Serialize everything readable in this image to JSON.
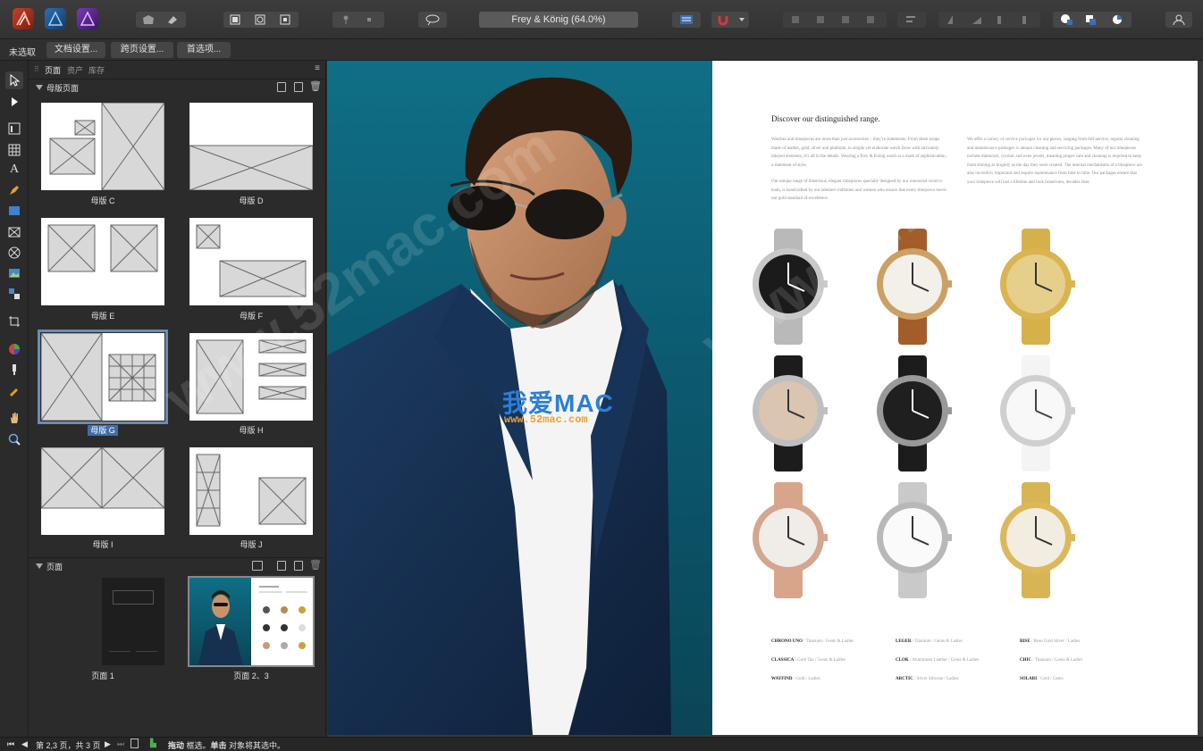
{
  "toolbar": {
    "apps": [
      "affinity-publisher-icon",
      "affinity-designer-icon",
      "affinity-photo-icon"
    ],
    "document_title": "Frey & König (64.0%)"
  },
  "context_bar": {
    "selection_label": "未选取",
    "doc_setup_button": "文档设置...",
    "spread_setup_button": "跨页设置...",
    "preferences_button": "首选项..."
  },
  "panel": {
    "tabs": [
      "页面",
      "资产",
      "库存"
    ],
    "master_section_title": "母版页面",
    "pages_section_title": "页面",
    "masters": [
      {
        "label": "母版 C"
      },
      {
        "label": "母版 D"
      },
      {
        "label": "母版 E"
      },
      {
        "label": "母版 F"
      },
      {
        "label": "母版 G",
        "selected": true
      },
      {
        "label": "母版 H"
      },
      {
        "label": "母版 I"
      },
      {
        "label": "母版 J"
      }
    ],
    "pages": [
      {
        "label": "页面 1"
      },
      {
        "label": "页面 2、3",
        "selected": true
      }
    ]
  },
  "document": {
    "heading": "Discover our distinguished range.",
    "para_left": "Watches and timepieces are more than just accessories – they’re statements. From sleek straps made of leather, gold, silver and platinum, to simple yet elaborate watch faces with intricately inlayed elements, it’s all in the details. Wearing a Frey & König watch is a mark of sophistication, a statement of style.",
    "para_left2": "Our unique range of illustrious, elegant timepieces specially designed by our renowned creative team, is handcrafted by our talented craftsmen and women who ensure that every timepiece meets our gold standard of excellence.",
    "para_right": "We offer a variety of service packages for our pieces, ranging from full-service, regular cleaning and maintenance packages to annual cleaning and servicing packages. Many of our timepieces include diamonds, crystals and even jewels, meaning proper care and cleaning is required to keep them shining as brightly as the day they were created. The internal mechanisms of a timepiece are also incredibly important and require maintenance from time to time. Our packages ensure that your timepiece will last a lifetime and look brand-new, decades later.",
    "specs": [
      {
        "name": "CHRONO UNO",
        "detail": " / Titanium / Gents & Ladies"
      },
      {
        "name": "LEGER",
        "detail": " / Titanium / Gents & Ladies"
      },
      {
        "name": "RISE",
        "detail": " / Rose Gold Silver / Ladies"
      },
      {
        "name": "CLASSICA",
        "detail": " / Gold Tan / Gents & Ladies"
      },
      {
        "name": "CLOK",
        "detail": " / Aluminium Leather / Gents & Ladies"
      },
      {
        "name": "CHIC",
        "detail": " / Titanium / Gents & Ladies"
      },
      {
        "name": "WAYFIND",
        "detail": " / Gold / Ladies"
      },
      {
        "name": "ARCTIC",
        "detail": " / Silver Silicone / Ladies"
      },
      {
        "name": "SOLARI",
        "detail": " / Gold / Gents"
      }
    ],
    "watermark_cn": "我爱MAC",
    "watermark_url": "www.52mac.com"
  },
  "watermark_bg": "www.52mac.com",
  "status_bar": {
    "page_info": "第 2,3 页，共 3 页",
    "hint_bold1": "拖动",
    "hint1": " 框选。",
    "hint_bold2": "单击",
    "hint2": " 对象将其选中。"
  },
  "colors": {
    "selection_blue": "#3f6ea8",
    "canvas_teal": "#0f6f86",
    "watermark_blue": "#2a7fd8",
    "watermark_orange": "#f0a030"
  }
}
